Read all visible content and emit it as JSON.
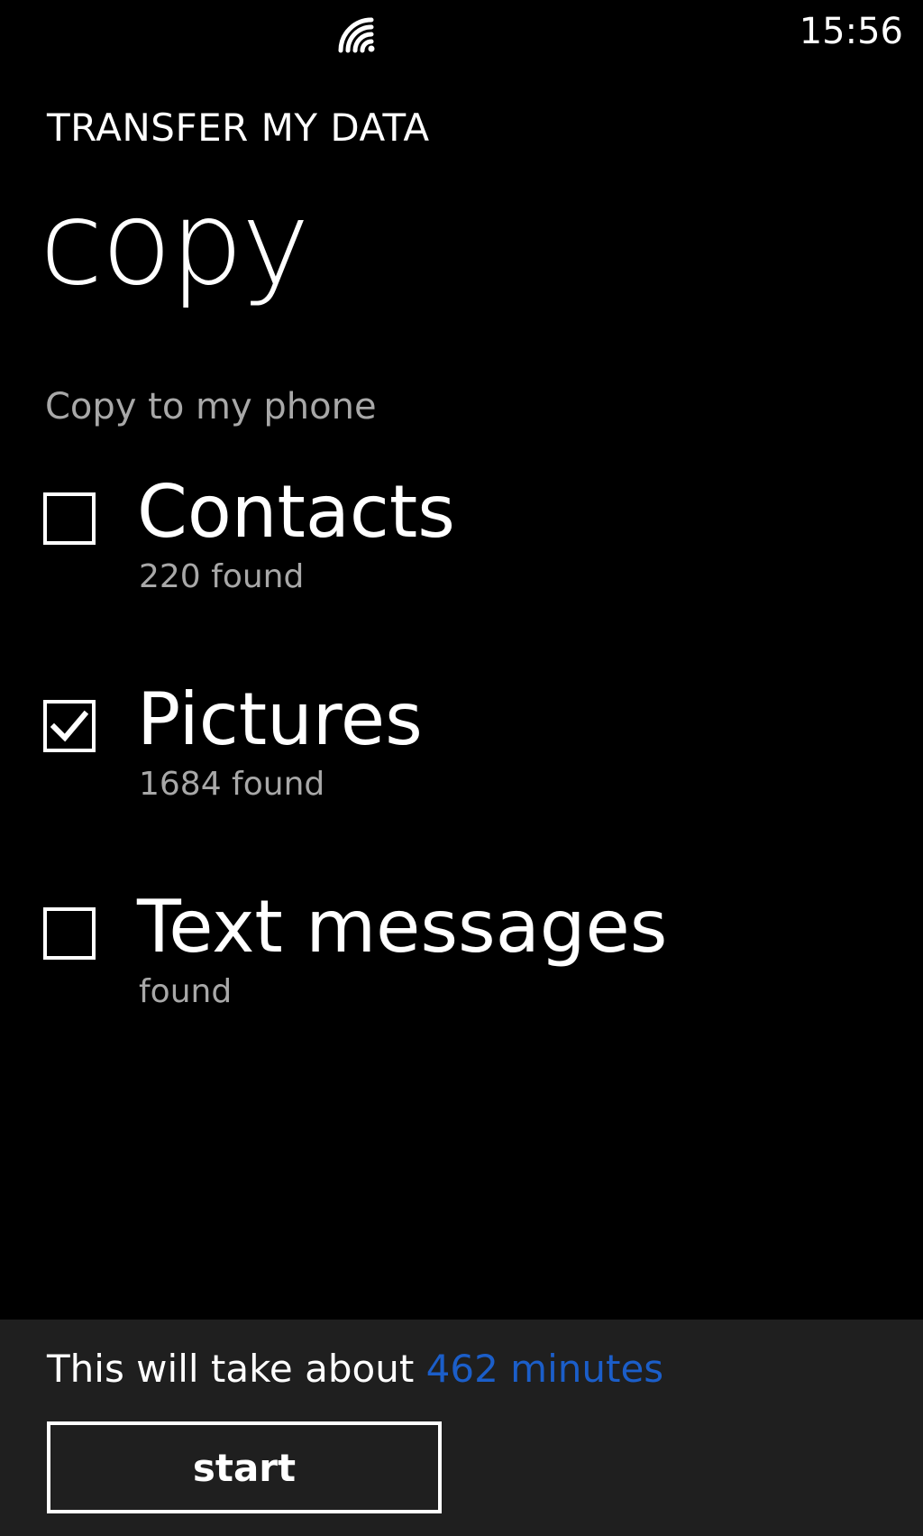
{
  "status_bar": {
    "wifi_icon": "wifi-icon",
    "time": "15:56"
  },
  "header": {
    "app_title": "TRANSFER MY DATA",
    "page_title": "copy"
  },
  "section": {
    "label": "Copy to my phone"
  },
  "options": [
    {
      "label": "Contacts",
      "sub": "220 found",
      "checked": false
    },
    {
      "label": "Pictures",
      "sub": "1684 found",
      "checked": true
    },
    {
      "label": "Text messages",
      "sub": "found",
      "checked": false
    }
  ],
  "footer": {
    "estimate_prefix": "This will take about ",
    "estimate_value": "462 minutes",
    "start_label": "start"
  },
  "colors": {
    "background": "#000000",
    "panel": "#1f1f1f",
    "accent": "#1b5ec9",
    "subtle_text": "#a8a8a8"
  }
}
